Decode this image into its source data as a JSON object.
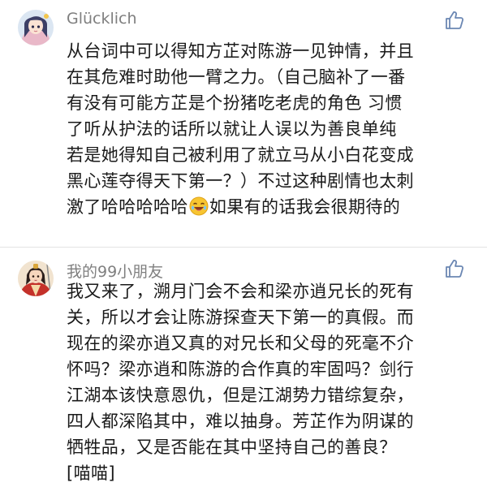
{
  "comments": [
    {
      "username": "Glücklich",
      "lines": [
        "从台词中可以得知方芷对陈游一见钟情，并且",
        "在其危难时助他一臂之力。（自己脑补了一番",
        "有没有可能方芷是个扮猪吃老虎的角色 习惯",
        "了听从护法的话所以就让人误以为善良单纯",
        "若是她得知自己被利用了就立马从小白花变成",
        "黑心莲夺得天下第一？）不过这种剧情也太刺"
      ],
      "last_line_before_emoji": "激了哈哈哈哈哈",
      "last_line_after_emoji": "如果有的话我会很期待的",
      "avatar_icon": "anime-girl-avatar-icon",
      "like_icon": "thumbs-up-icon",
      "emoji_icon": "laughing-emoji-icon"
    },
    {
      "username": "我的99小朋友",
      "lines": [
        "我又来了，溯月门会不会和梁亦逍兄长的死有",
        "关，所以才会让陈游探查天下第一的真假。而",
        "现在的梁亦逍又真的对兄长和父母的死毫不介",
        "怀吗？梁亦逍和陈游的合作真的牢固吗？剑行",
        "江湖本该快意恩仇，但是江湖势力错综复杂，",
        "四人都深陷其中，难以抽身。芳芷作为阴谋的",
        "牺牲品，又是否能在其中坚持自己的善良？",
        "[喵喵]"
      ],
      "avatar_icon": "costume-character-avatar-icon",
      "like_icon": "thumbs-up-icon"
    }
  ],
  "colors": {
    "username": "#7f7f7f",
    "text": "#1a1a1a",
    "like_icon": "#6b87b3",
    "divider": "#e4e4e4"
  }
}
